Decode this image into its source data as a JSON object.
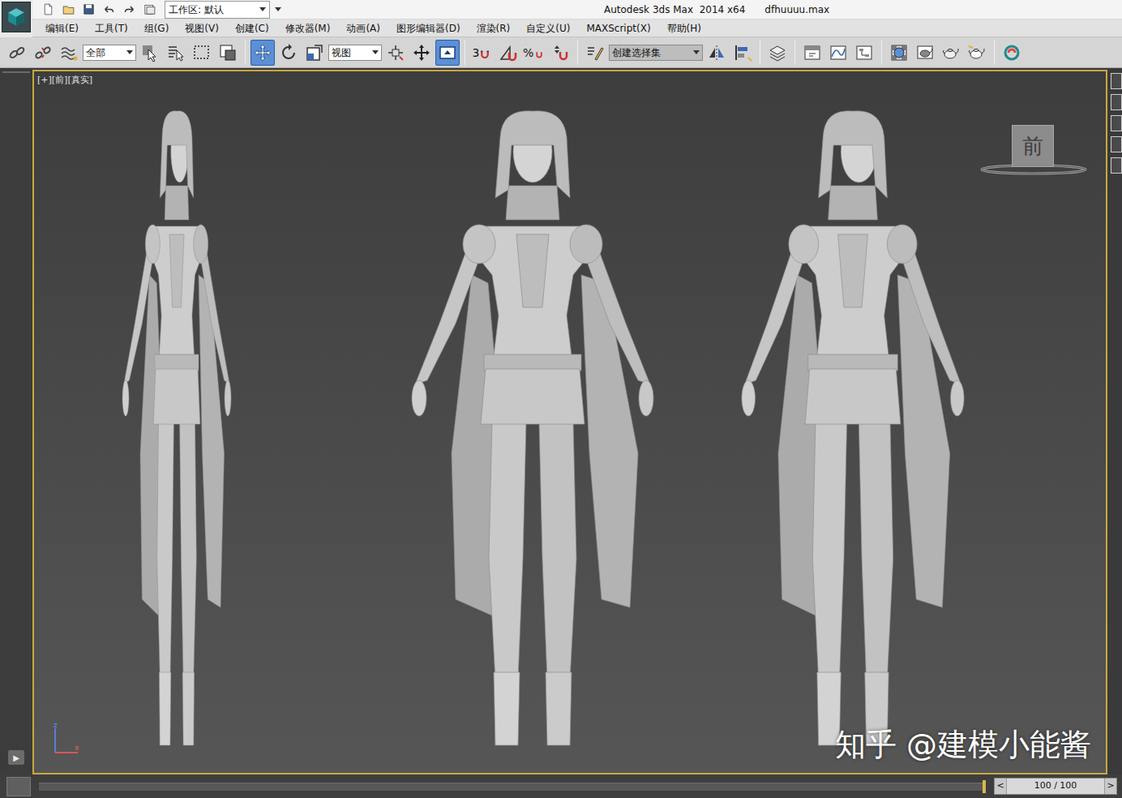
{
  "titlebar": {
    "workspace": "工作区: 默认",
    "title": "Autodesk 3ds Max  2014 x64",
    "file": "dfhuuuu.max"
  },
  "menu": [
    "编辑(E)",
    "工具(T)",
    "组(G)",
    "视图(V)",
    "创建(C)",
    "修改器(M)",
    "动画(A)",
    "图形编辑器(D)",
    "渲染(R)",
    "自定义(U)",
    "MAXScript(X)",
    "帮助(H)"
  ],
  "toolbar": [
    {
      "kind": "button",
      "selected": false
    },
    {
      "kind": "button",
      "selected": false
    },
    {
      "kind": "button",
      "selected": false
    },
    {
      "kind": "dropdown",
      "value": "全部"
    },
    {
      "kind": "button",
      "selected": false
    },
    {
      "kind": "button",
      "selected": false
    },
    {
      "kind": "button",
      "selected": false
    },
    {
      "kind": "button",
      "selected": false
    },
    {
      "kind": "separator"
    },
    {
      "kind": "button",
      "selected": true
    },
    {
      "kind": "button",
      "selected": false
    },
    {
      "kind": "button",
      "selected": false
    },
    {
      "kind": "dropdown",
      "value": "视图"
    },
    {
      "kind": "button",
      "selected": false
    },
    {
      "kind": "button",
      "selected": false
    },
    {
      "kind": "button",
      "selected": true
    },
    {
      "kind": "separator"
    },
    {
      "kind": "button",
      "selected": false,
      "label": "3"
    },
    {
      "kind": "button",
      "selected": false
    },
    {
      "kind": "button",
      "selected": false,
      "label": "%"
    },
    {
      "kind": "button",
      "selected": false
    },
    {
      "kind": "separator"
    },
    {
      "kind": "button",
      "selected": false
    },
    {
      "kind": "dropdown",
      "value": "创建选择集"
    },
    {
      "kind": "button",
      "selected": false
    },
    {
      "kind": "button",
      "selected": false
    },
    {
      "kind": "separator"
    },
    {
      "kind": "button",
      "selected": false
    },
    {
      "kind": "separator"
    },
    {
      "kind": "button",
      "selected": false
    },
    {
      "kind": "button",
      "selected": false
    },
    {
      "kind": "button",
      "selected": false
    },
    {
      "kind": "separator"
    },
    {
      "kind": "button",
      "selected": false
    },
    {
      "kind": "button",
      "selected": false
    },
    {
      "kind": "button",
      "selected": false
    },
    {
      "kind": "button",
      "selected": false
    },
    {
      "kind": "separator"
    },
    {
      "kind": "button",
      "selected": false
    }
  ],
  "viewport": {
    "labels": [
      "[+]",
      "[前]",
      "[真实]"
    ],
    "viewcube": "前",
    "axes": [
      "z",
      "x"
    ],
    "active": true,
    "watermark": "知乎 @建模小能酱"
  },
  "sidebar": {
    "play": "▶"
  },
  "timeline": {
    "prev": "<",
    "frame": "100 / 100",
    "next": ">",
    "level": 1
  }
}
